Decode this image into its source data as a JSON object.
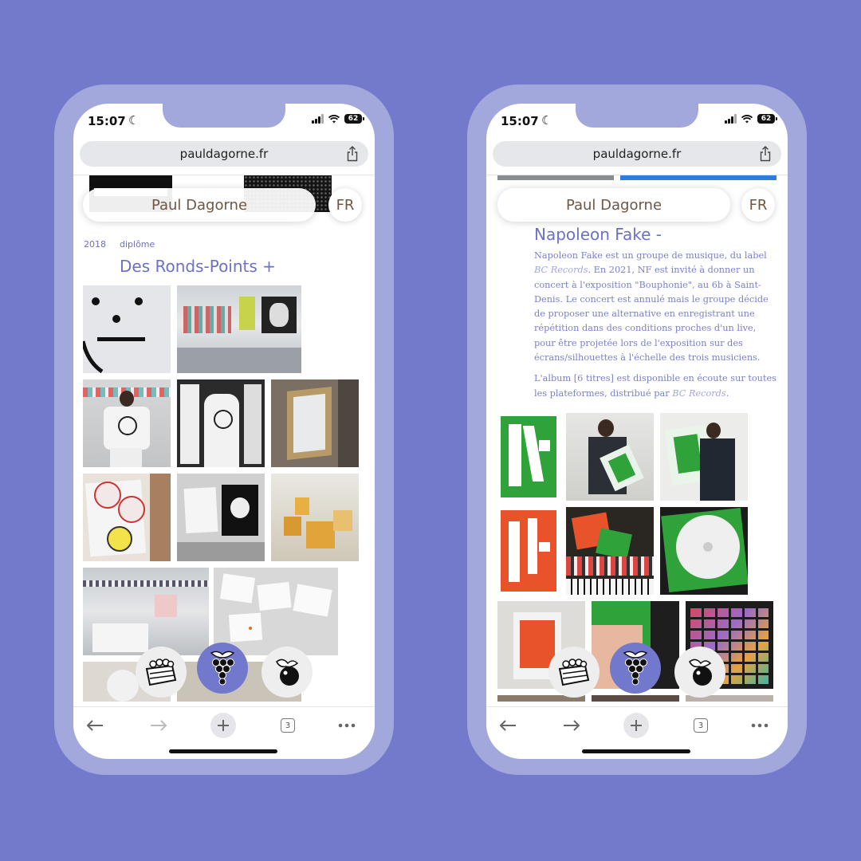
{
  "colors": {
    "background": "#7379cb",
    "phone_frame": "#a3a8dc",
    "accent": "#6c71c5",
    "name_text": "#6e5643"
  },
  "phones": [
    {
      "status": {
        "time": "15:07",
        "battery": "62"
      },
      "url": "pauldagorne.fr",
      "name_pill": "Paul Dagorne",
      "lang_button": "FR",
      "project": {
        "year": "2018",
        "category": "diplôme",
        "title": "Des Ronds-Points +"
      },
      "toolbar": {
        "tabs_count": "3"
      },
      "dock": [
        "crate-icon",
        "grapes-icon",
        "fruit-icon"
      ]
    },
    {
      "status": {
        "time": "15:07",
        "battery": "62"
      },
      "url": "pauldagorne.fr",
      "name_pill": "Paul Dagorne",
      "lang_button": "FR",
      "project": {
        "title": "Napoleon Fake -",
        "p1_a": "Napoleon Fake est un groupe de musique, du label ",
        "p1_label": "BC Records",
        "p1_b": ". En 2021, NF est invité à donner un concert à l'exposition \"Bouphonie\", au 6b à Saint-Denis. Le concert est annulé mais le groupe décide de proposer une alternative en enregistrant une répétition dans des conditions proches d'un live, pour être projetée lors de l'exposition sur des écrans/silhouettes à l'échelle des trois musiciens.",
        "p2_a": "L'album [6 titres] est disponible en écoute sur toutes les plateformes, distribué par ",
        "p2_label": "BC Records",
        "p2_b": "."
      },
      "toolbar": {
        "tabs_count": "3"
      },
      "dock": [
        "crate-icon",
        "grapes-icon",
        "fruit-icon"
      ]
    }
  ]
}
